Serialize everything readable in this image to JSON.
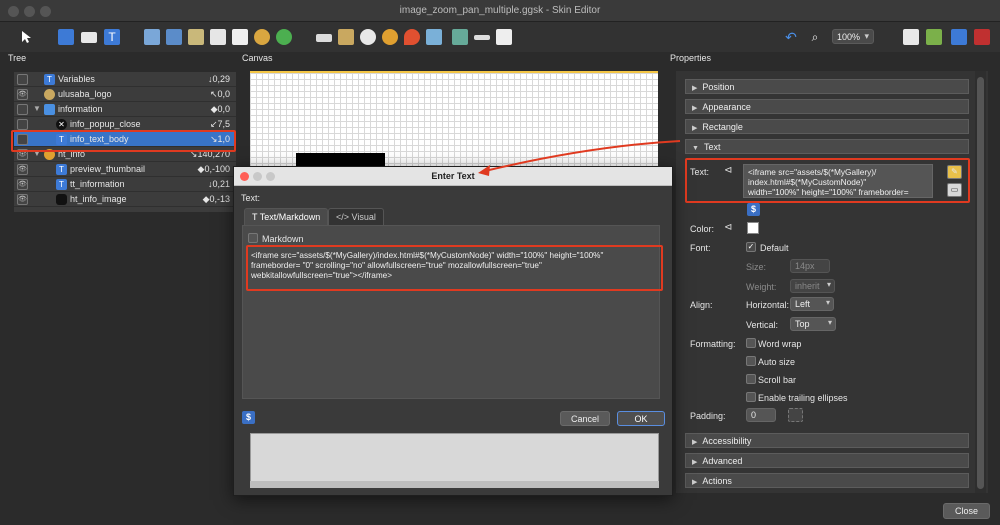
{
  "window": {
    "title": "image_zoom_pan_multiple.ggsk - Skin Editor"
  },
  "toolbar": {
    "zoom": "100%"
  },
  "panels": {
    "tree": "Tree",
    "canvas": "Canvas",
    "properties": "Properties"
  },
  "tree": {
    "rows": [
      {
        "name": "Variables",
        "value": "↓0,29"
      },
      {
        "name": "ulusaba_logo",
        "value": "↖0,0"
      },
      {
        "name": "information",
        "value": "◆0,0"
      },
      {
        "name": "info_popup_close",
        "value": "↙7,5"
      },
      {
        "name": "info_text_body",
        "value": "↘1,0"
      },
      {
        "name": "ht_info",
        "value": "↘140,270"
      },
      {
        "name": "preview_thumbnail",
        "value": "◆0,-100"
      },
      {
        "name": "tt_information",
        "value": "↓0,21"
      },
      {
        "name": "ht_info_image",
        "value": "◆0,-13"
      }
    ]
  },
  "dialog": {
    "title": "Enter Text",
    "text_label": "Text:",
    "tab_markdown": "Text/Markdown",
    "tab_visual": "Visual",
    "markdown_label": "Markdown",
    "code_line1": "<iframe src=\"assets/$(*MyGallery)/index.html#$(*MyCustomNode)\" width=\"100%\" height=\"100%\"",
    "code_line2": "frameborder= \"0\" scrolling=\"no\" allowfullscreen=\"true\" mozallowfullscreen=\"true\"",
    "code_line3": "webkitallowfullscreen=\"true\"></iframe>",
    "dollar": "$",
    "cancel": "Cancel",
    "ok": "OK"
  },
  "properties": {
    "groups": {
      "position": "Position",
      "appearance": "Appearance",
      "rectangle": "Rectangle",
      "text": "Text",
      "accessibility": "Accessibility",
      "advanced": "Advanced",
      "actions": "Actions"
    },
    "text_label": "Text:",
    "text_line1": "<iframe src=\"assets/$(*MyGallery)/",
    "text_line2": "index.html#$(*MyCustomNode)\"",
    "text_line3": "width=\"100%\" height=\"100%\" frameborder=",
    "dollar": "$",
    "color_label": "Color:",
    "font_label": "Font:",
    "font_default": "Default",
    "size_label": "Size:",
    "size_value": "14px",
    "weight_label": "Weight:",
    "weight_value": "inherit",
    "align_label": "Align:",
    "horizontal_label": "Horizontal:",
    "horizontal_value": "Left",
    "vertical_label": "Vertical:",
    "vertical_value": "Top",
    "formatting_label": "Formatting:",
    "word_wrap": "Word wrap",
    "auto_size": "Auto size",
    "scroll_bar": "Scroll bar",
    "ellipses": "Enable trailing ellipses",
    "padding_label": "Padding:",
    "padding_value": "0"
  },
  "footer": {
    "close": "Close"
  }
}
